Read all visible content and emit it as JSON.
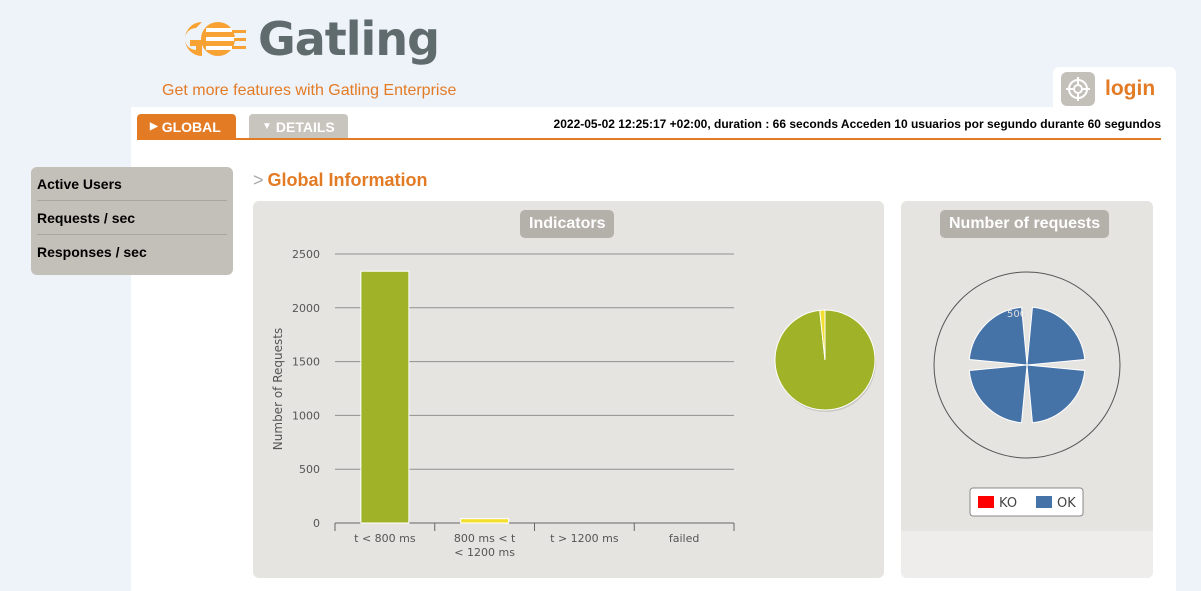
{
  "brand": {
    "name": "Gatling",
    "enterprise_link": "Get more features with Gatling Enterprise"
  },
  "login": {
    "label": "login",
    "icon": "target-icon"
  },
  "tabs": [
    {
      "label": "GLOBAL",
      "icon": "triangle-right-icon",
      "active": true
    },
    {
      "label": "DETAILS",
      "icon": "triangle-down-icon",
      "active": false
    }
  ],
  "run_info": "2022-05-02 12:25:17 +02:00, duration : 66 seconds Acceden 10 usuarios por segundo durante 60 segundos",
  "side_menu": [
    {
      "label": "Active Users"
    },
    {
      "label": "Requests / sec"
    },
    {
      "label": "Responses / sec"
    }
  ],
  "section_title": "Global Information",
  "colors": {
    "accent": "#e37b25",
    "ok_green": "#a0b228",
    "warn_yellow": "#f3e02e",
    "ok_blue": "#4572a7",
    "ko_red": "#ff0000"
  },
  "chart_data": [
    {
      "type": "bar",
      "title": "Indicators",
      "ylabel": "Number of Requests",
      "categories": [
        "t < 800 ms",
        "800 ms < t < 1200 ms",
        "t > 1200 ms",
        "failed"
      ],
      "values": [
        2340,
        40,
        0,
        0
      ],
      "ylim": [
        0,
        2500
      ],
      "yticks": [
        0,
        500,
        1000,
        1500,
        2000,
        2500
      ],
      "grid": true,
      "series_colors": [
        "#a0b228",
        "#f3e02e",
        "#e37b25",
        "#ff0000"
      ]
    },
    {
      "type": "pie",
      "slices": [
        {
          "label": "t < 800 ms",
          "value": 2340,
          "color": "#a0b228"
        },
        {
          "label": "800 ms < t < 1200 ms",
          "value": 40,
          "color": "#f3e02e"
        }
      ]
    },
    {
      "type": "polar",
      "title": "Number of requests",
      "radial_tick_label": "500",
      "legend": [
        {
          "name": "KO",
          "color": "#ff0000"
        },
        {
          "name": "OK",
          "color": "#4572a7"
        }
      ],
      "legend_position": "bottom"
    }
  ]
}
